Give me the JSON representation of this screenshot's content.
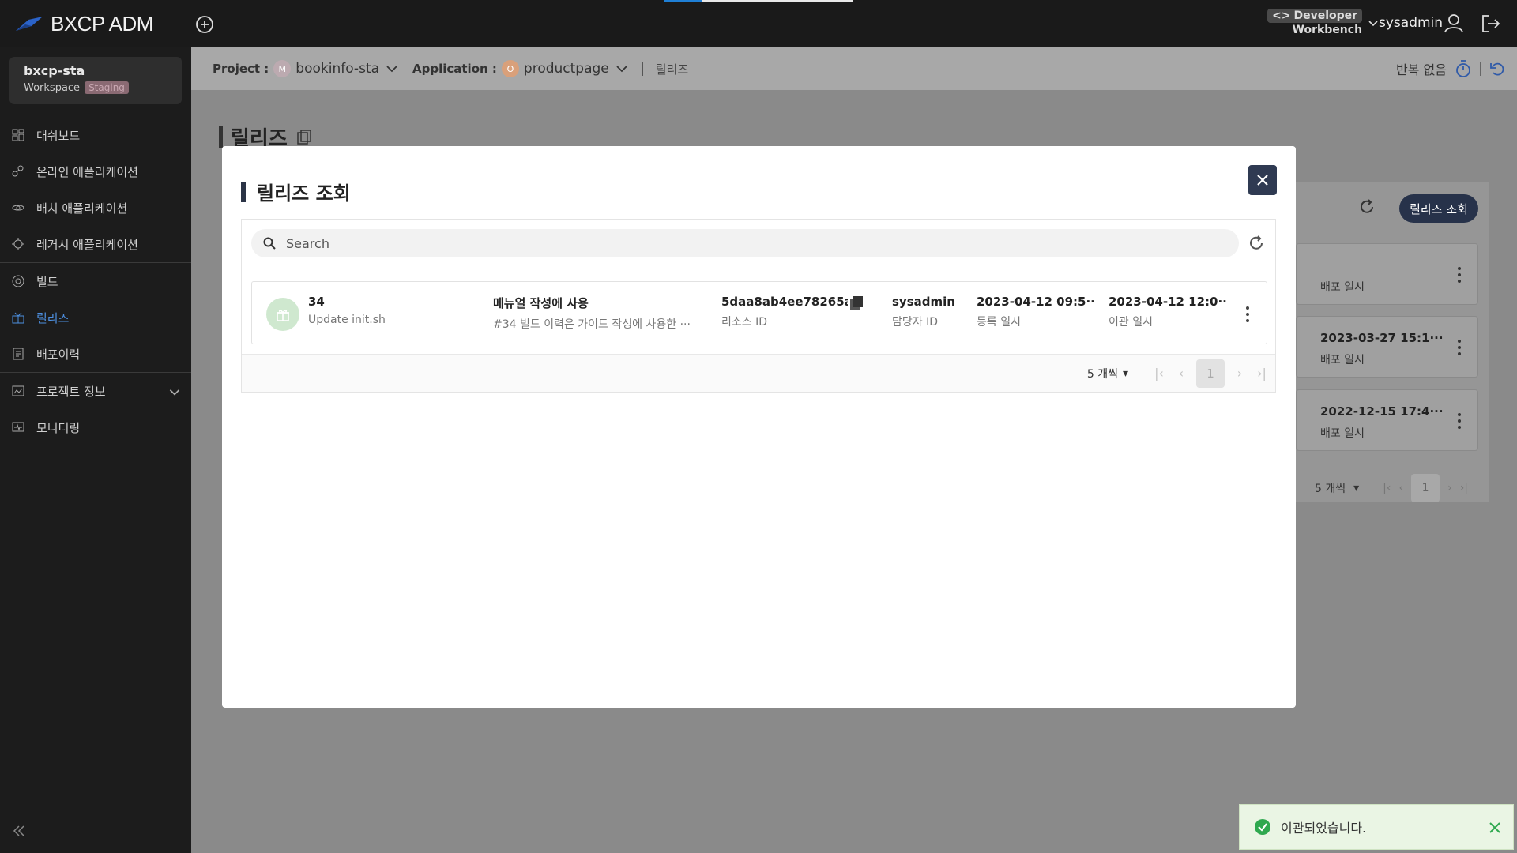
{
  "app": {
    "brand": "BXCP ADM"
  },
  "topbar": {
    "dev_badge": "Developer",
    "dev_sub": "Workbench",
    "user": "sysadmin"
  },
  "workspace": {
    "name": "bxcp-sta",
    "label": "Workspace",
    "badge": "Staging"
  },
  "sidebar": {
    "items": [
      {
        "label": "대쉬보드",
        "icon": "dashboard-icon"
      },
      {
        "label": "온라인 애플리케이션",
        "icon": "online-app-icon"
      },
      {
        "label": "배치 애플리케이션",
        "icon": "batch-app-icon"
      },
      {
        "label": "레거시 애플리케이션",
        "icon": "legacy-app-icon"
      },
      {
        "label": "빌드",
        "icon": "build-icon"
      },
      {
        "label": "릴리즈",
        "icon": "release-icon",
        "active": true
      },
      {
        "label": "배포이력",
        "icon": "deploy-history-icon"
      },
      {
        "label": "프로젝트 정보",
        "icon": "project-info-icon"
      },
      {
        "label": "모니터링",
        "icon": "monitoring-icon"
      }
    ]
  },
  "context": {
    "project_label": "Project :",
    "project_avatar": "M",
    "project_value": "bookinfo-sta",
    "application_label": "Application :",
    "application_avatar": "O",
    "application_value": "productpage",
    "crumb": "릴리즈",
    "repeat": "반복 없음"
  },
  "page": {
    "title": "릴리즈",
    "release_button": "릴리즈 조회",
    "cards": [
      {
        "date": "",
        "sub": "배포 일시"
      },
      {
        "date": "2023-03-27 15:1···",
        "sub": "배포 일시"
      },
      {
        "date": "2022-12-15 17:4···",
        "sub": "배포 일시"
      }
    ],
    "per_page": "5 개씩",
    "page_num": "1"
  },
  "modal": {
    "title": "릴리즈 조회",
    "search_placeholder": "Search",
    "row": {
      "number": "34",
      "commit": "Update init.sh",
      "memo_title": "메뉴얼 작성에 사용",
      "memo_desc": "#34 빌드 이력은 가이드 작성에 사용한 ···",
      "resource_id": "5daa8ab4ee78265a···",
      "resource_id_label": "리소스 ID",
      "owner": "sysadmin",
      "owner_label": "담당자 ID",
      "registered": "2023-04-12 09:5···",
      "registered_label": "등록 일시",
      "transferred": "2023-04-12 12:0···",
      "transferred_label": "이관 일시"
    },
    "per_page": "5 개씩",
    "page_num": "1"
  },
  "toast": {
    "message": "이관되었습니다."
  },
  "colors": {
    "accent": "#2f3a52",
    "active": "#4d8fe0",
    "success": "#2fa84f"
  }
}
